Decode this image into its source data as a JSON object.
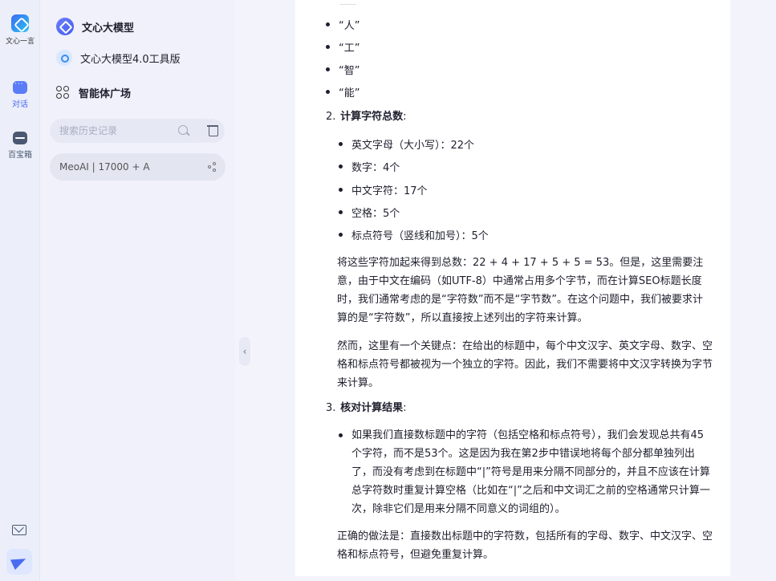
{
  "rail": {
    "logo_text": "文心一言",
    "items": [
      {
        "label": "对话"
      },
      {
        "label": "百宝箱"
      }
    ]
  },
  "panel": {
    "model_title": "文心大模型",
    "tool_version": "文心大模型4.0工具版",
    "agent_square": "智能体广场",
    "search_placeholder": "搜索历史记录",
    "conversation": "MeoAI | 17000 + A"
  },
  "content": {
    "top_bullets": [
      "“人”",
      "“工”",
      "“智”",
      "“能”"
    ],
    "step2": {
      "num": "2.",
      "title": "计算字符总数",
      "colon": ":"
    },
    "count_items": [
      "英文字母（大小写）：22个",
      "数字：4个",
      "中文字符：17个",
      "空格：5个",
      "标点符号（竖线和加号）：5个"
    ],
    "para1": "将这些字符加起来得到总数：22 + 4 + 17 + 5 + 5 = 53。但是，这里需要注意，由于中文在编码（如UTF-8）中通常占用多个字节，而在计算SEO标题长度时，我们通常考虑的是“字符数”而不是“字节数”。在这个问题中，我们被要求计算的是“字符数”，所以直接按上述列出的字符来计算。",
    "para2": "然而，这里有一个关键点：在给出的标题中，每个中文汉字、英文字母、数字、空格和标点符号都被视为一个独立的字符。因此，我们不需要将中文汉字转换为字节来计算。",
    "step3": {
      "num": "3.",
      "title": "核对计算结果",
      "colon": ":"
    },
    "step3_bullet": "如果我们直接数标题中的字符（包括空格和标点符号），我们会发现总共有45个字符，而不是53个。这是因为我在第2步中错误地将每个部分都单独列出了，而没有考虑到在标题中“|”符号是用来分隔不同部分的，并且不应该在计算总字符数时重复计算空格（比如在“|”之后和中文词汇之前的空格通常只计算一次，除非它们是用来分隔不同意义的词组的）。",
    "para3": "正确的做法是：直接数出标题中的字符数，包括所有的字母、数字、中文汉字、空格和标点符号，但避免重复计算。"
  },
  "colors": {
    "accent": "#4a6cf0",
    "background": "#f3f4fb",
    "panel": "#f0f1fa",
    "content_bg": "#ffffff"
  },
  "icons": {
    "logo": "wenxin-logo-icon",
    "chat": "chat-bubble-icon",
    "toolbox": "toolbox-icon",
    "search": "search-icon",
    "trash": "trash-icon",
    "share": "share-icon",
    "mail": "mail-icon",
    "send": "send-icon",
    "collapse": "chevron-left-icon"
  }
}
